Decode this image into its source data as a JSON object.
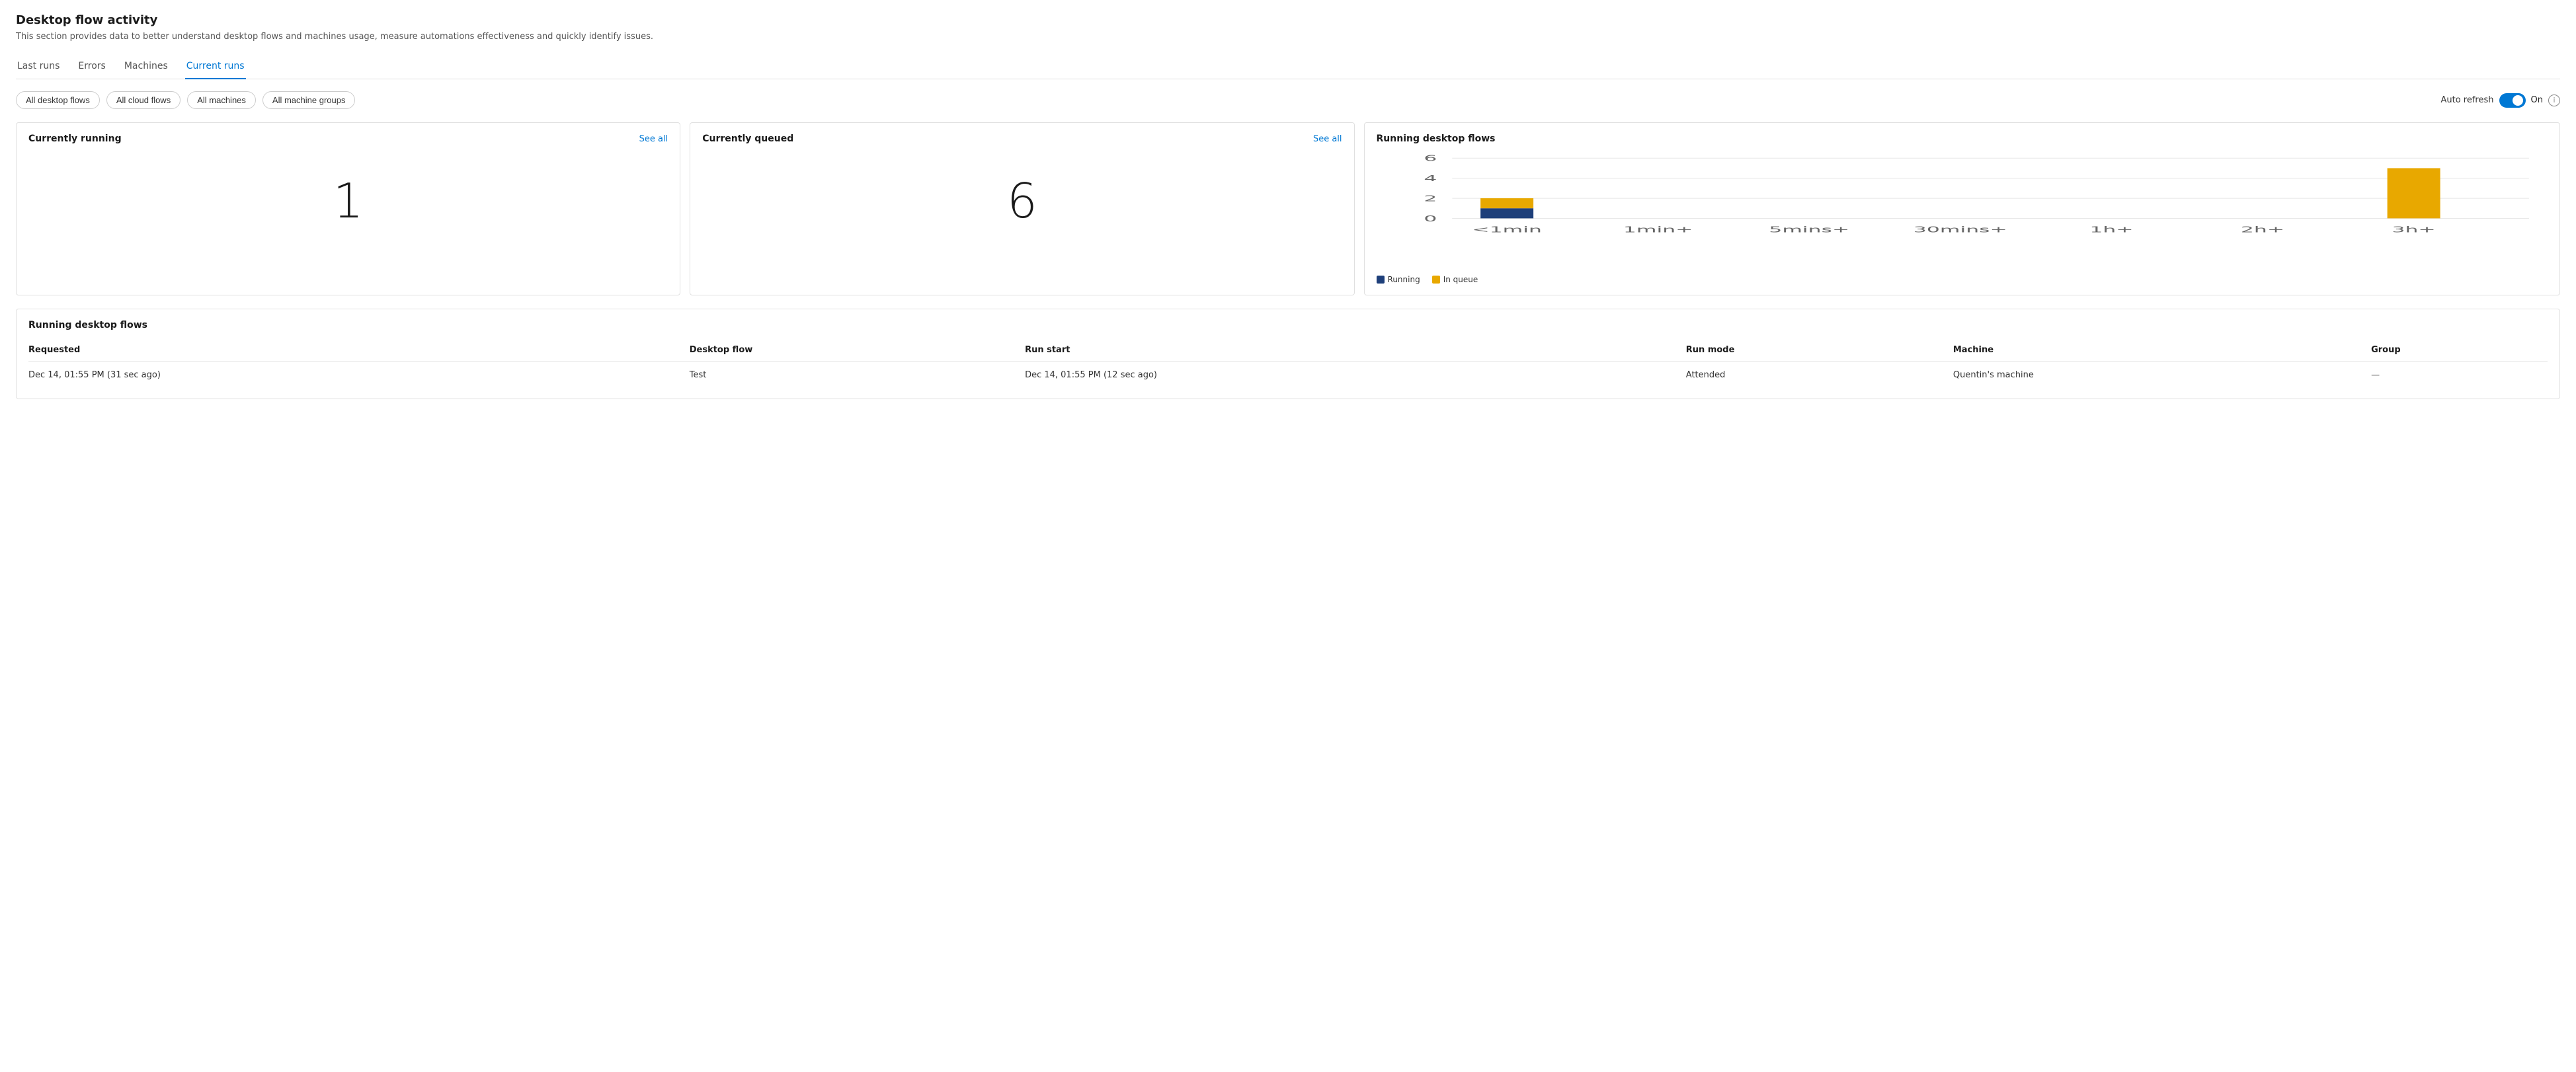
{
  "page": {
    "title": "Desktop flow activity",
    "subtitle": "This section provides data to better understand desktop flows and machines usage, measure automations effectiveness and quickly identify issues."
  },
  "tabs": [
    {
      "label": "Last runs",
      "active": false
    },
    {
      "label": "Errors",
      "active": false
    },
    {
      "label": "Machines",
      "active": false
    },
    {
      "label": "Current runs",
      "active": true
    }
  ],
  "filters": [
    {
      "label": "All desktop flows"
    },
    {
      "label": "All cloud flows"
    },
    {
      "label": "All machines"
    },
    {
      "label": "All machine groups"
    }
  ],
  "auto_refresh": {
    "label": "Auto refresh",
    "toggle_state": "On"
  },
  "currently_running": {
    "title": "Currently running",
    "see_all": "See all",
    "count": "1"
  },
  "currently_queued": {
    "title": "Currently queued",
    "see_all": "See all",
    "count": "6"
  },
  "running_desktop_flows_chart": {
    "title": "Running desktop flows",
    "y_labels": [
      "0",
      "2",
      "4",
      "6"
    ],
    "x_labels": [
      "<1min",
      "1min+",
      "5mins+",
      "30mins+",
      "1h+",
      "2h+",
      "3h+"
    ],
    "bars": [
      {
        "label": "<1min",
        "running": 1,
        "in_queue": 1
      },
      {
        "label": "1min+",
        "running": 0,
        "in_queue": 0
      },
      {
        "label": "5mins+",
        "running": 0,
        "in_queue": 0
      },
      {
        "label": "30mins+",
        "running": 0,
        "in_queue": 0
      },
      {
        "label": "1h+",
        "running": 0,
        "in_queue": 0
      },
      {
        "label": "2h+",
        "running": 0,
        "in_queue": 0
      },
      {
        "label": "3h+",
        "running": 0,
        "in_queue": 5
      }
    ],
    "max_value": 6,
    "legend": [
      {
        "label": "Running",
        "color": "#1e3f7a"
      },
      {
        "label": "In queue",
        "color": "#e8a800"
      }
    ]
  },
  "running_flows_table": {
    "title": "Running desktop flows",
    "columns": [
      "Requested",
      "Desktop flow",
      "Run start",
      "Run mode",
      "Machine",
      "Group"
    ],
    "rows": [
      {
        "requested": "Dec 14, 01:55 PM (31 sec ago)",
        "desktop_flow": "Test",
        "run_start": "Dec 14, 01:55 PM (12 sec ago)",
        "run_mode": "Attended",
        "machine": "Quentin's machine",
        "group": "—"
      }
    ]
  }
}
